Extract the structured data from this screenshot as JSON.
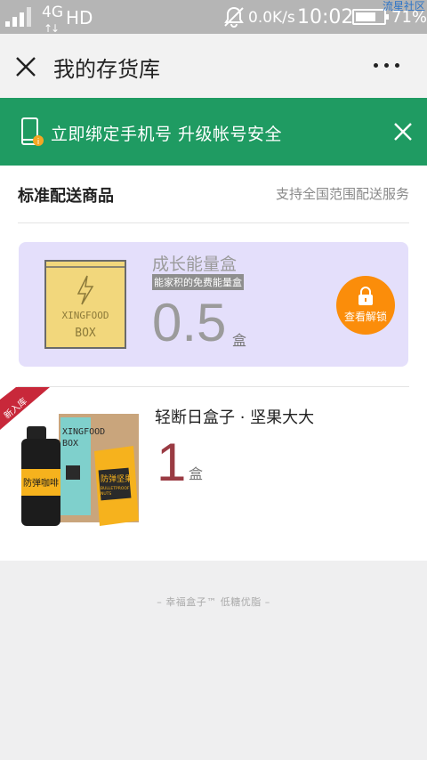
{
  "status_bar": {
    "network": "4G",
    "network_mode": "HD",
    "speed": "0.0K/s",
    "time": "10:02",
    "battery_percent": "71%",
    "battery_level": 0.71,
    "watermark": "流星社区"
  },
  "header": {
    "title": "我的存货库",
    "close_icon": "close-icon",
    "more_icon": "more-dots-icon"
  },
  "banner": {
    "text": "立即绑定手机号  升级帐号安全",
    "color": "#1f9b62"
  },
  "section": {
    "title": "标准配送商品",
    "subtitle": "支持全国范围配送服务"
  },
  "energy_card": {
    "name": "成长能量盒",
    "tag": "能家积的免费能量盒",
    "value": "0.5",
    "unit": "盒",
    "box_text_1": "XINGFOOD",
    "box_text_2": "BOX",
    "unlock_label": "查看解锁",
    "accent": "#fb8d0a"
  },
  "product": {
    "ribbon": "新入库",
    "name": "轻断日盒子 · 坚果大大",
    "quantity": "1",
    "unit": "盒",
    "box_text_1": "XINGFOOD",
    "box_text_2": "BOX",
    "pouch_text": "防弹坚果",
    "pouch_sub": "BULLETPROOF",
    "pouch_sub2": "NUTS",
    "can_text": "防弹咖啡"
  },
  "footer": {
    "text": "– 幸福盒子™ 低糖优脂 –"
  }
}
